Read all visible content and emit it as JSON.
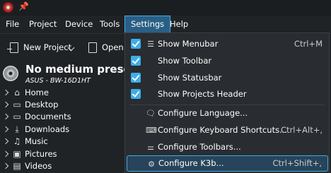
{
  "menubar": {
    "items": [
      {
        "label": "File"
      },
      {
        "label": "Project"
      },
      {
        "label": "Device"
      },
      {
        "label": "Tools"
      },
      {
        "label": "Settings",
        "active": true
      },
      {
        "label": "Help"
      }
    ]
  },
  "toolbar": {
    "new_project_label": "New Project",
    "open_label": "Open..."
  },
  "device": {
    "title": "No medium present",
    "drive": "ASUS - BW-16D1HT"
  },
  "tree": {
    "items": [
      {
        "label": "Home",
        "icon": "home-icon"
      },
      {
        "label": "Desktop",
        "icon": "folder-icon"
      },
      {
        "label": "Documents",
        "icon": "folder-icon"
      },
      {
        "label": "Downloads",
        "icon": "download-icon"
      },
      {
        "label": "Music",
        "icon": "music-icon"
      },
      {
        "label": "Pictures",
        "icon": "pictures-icon"
      },
      {
        "label": "Videos",
        "icon": "videos-icon"
      }
    ]
  },
  "settings_menu": {
    "items": [
      {
        "label": "Show Menubar",
        "shortcut": "Ctrl+M",
        "checked": true,
        "icon": "menubar-icon"
      },
      {
        "label": "Show Toolbar",
        "shortcut": "",
        "checked": true
      },
      {
        "label": "Show Statusbar",
        "shortcut": "",
        "checked": true
      },
      {
        "label": "Show Projects Header",
        "shortcut": "",
        "checked": true
      },
      {
        "label": "Configure Language...",
        "shortcut": "",
        "icon": "language-icon"
      },
      {
        "label": "Configure Keyboard Shortcuts...",
        "shortcut": "Ctrl+Alt+,",
        "icon": "keyboard-icon"
      },
      {
        "label": "Configure Toolbars...",
        "shortcut": "",
        "icon": "toolbars-icon"
      },
      {
        "label": "Configure K3b...",
        "shortcut": "Ctrl+Shift+,",
        "icon": "configure-icon",
        "highlighted": true
      }
    ]
  },
  "colors": {
    "accent": "#3daee9",
    "background": "#202326",
    "menu_background": "#292c30"
  }
}
